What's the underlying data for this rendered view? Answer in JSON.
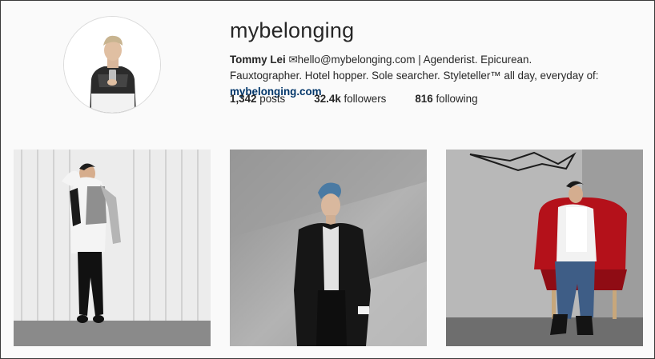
{
  "profile": {
    "username": "mybelonging",
    "bio": {
      "name": "Tommy Lei",
      "envelope_glyph": "✉",
      "text": "hello@mybelonging.com | Agenderist. Epicurean. Fauxtographer. Hotel hopper. Sole searcher. Styleteller™ all day, everyday of: ",
      "link": "mybelonging.com"
    },
    "stats": {
      "posts_count": "1,342",
      "posts_label": "posts",
      "followers_count": "32.4k",
      "followers_label": "followers",
      "following_count": "816",
      "following_label": "following"
    }
  },
  "posts": [
    {
      "alt_icon": "photo-man-white-wall"
    },
    {
      "alt_icon": "photo-man-grey-wall"
    },
    {
      "alt_icon": "photo-man-red-chair"
    }
  ],
  "colors": {
    "link": "#003569",
    "border": "#dbdbdb",
    "background": "#fafafa"
  }
}
